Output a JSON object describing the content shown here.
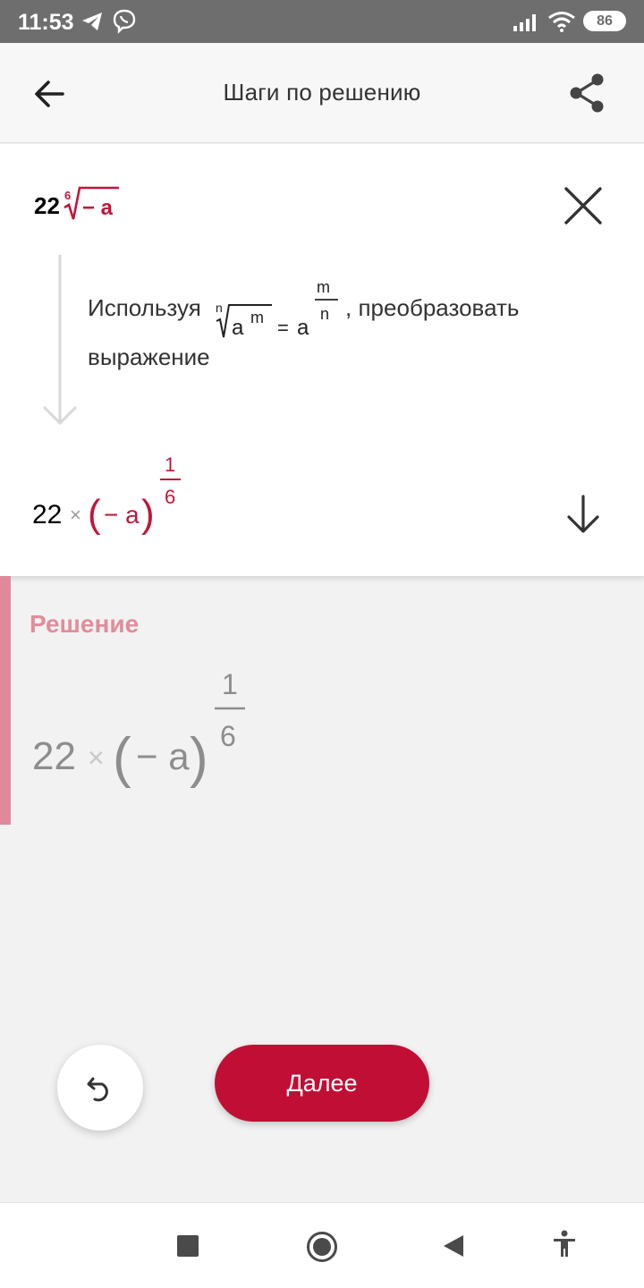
{
  "status_bar": {
    "time": "11:53",
    "battery": "86",
    "icons": [
      "telegram-icon",
      "viber-icon",
      "signal-icon",
      "wifi-icon",
      "battery-icon"
    ]
  },
  "app_bar": {
    "title": "Шаги по решению",
    "back_icon": "arrow-left-icon",
    "share_icon": "share-icon"
  },
  "step": {
    "original": {
      "coefficient": "22",
      "root_index": "6",
      "radicand": "− a"
    },
    "explanation": {
      "prefix": "Используя",
      "rule": {
        "index": "n",
        "base": "a",
        "exp": "m",
        "eq": "=",
        "rhs_base": "a",
        "num": "m",
        "den": "n"
      },
      "suffix_line1": ", преобразовать",
      "suffix_line2": "выражение"
    },
    "result": {
      "coefficient": "22",
      "times": "×",
      "lparen": "(",
      "inner": "− a",
      "rparen": ")",
      "num": "1",
      "den": "6"
    }
  },
  "solution": {
    "title": "Решение",
    "expr": {
      "coefficient": "22",
      "times": "×",
      "lparen": "(",
      "inner": "− a",
      "rparen": ")",
      "num": "1",
      "den": "6"
    }
  },
  "controls": {
    "undo_icon": "undo-icon",
    "next_label": "Далее"
  },
  "nav_bar": {
    "icons": [
      "recent-apps-icon",
      "home-icon",
      "back-triangle-icon",
      "accessibility-icon"
    ]
  },
  "colors": {
    "accent": "#c10e35",
    "math_red": "#c0173a",
    "solution_accent": "#de8a9a"
  }
}
